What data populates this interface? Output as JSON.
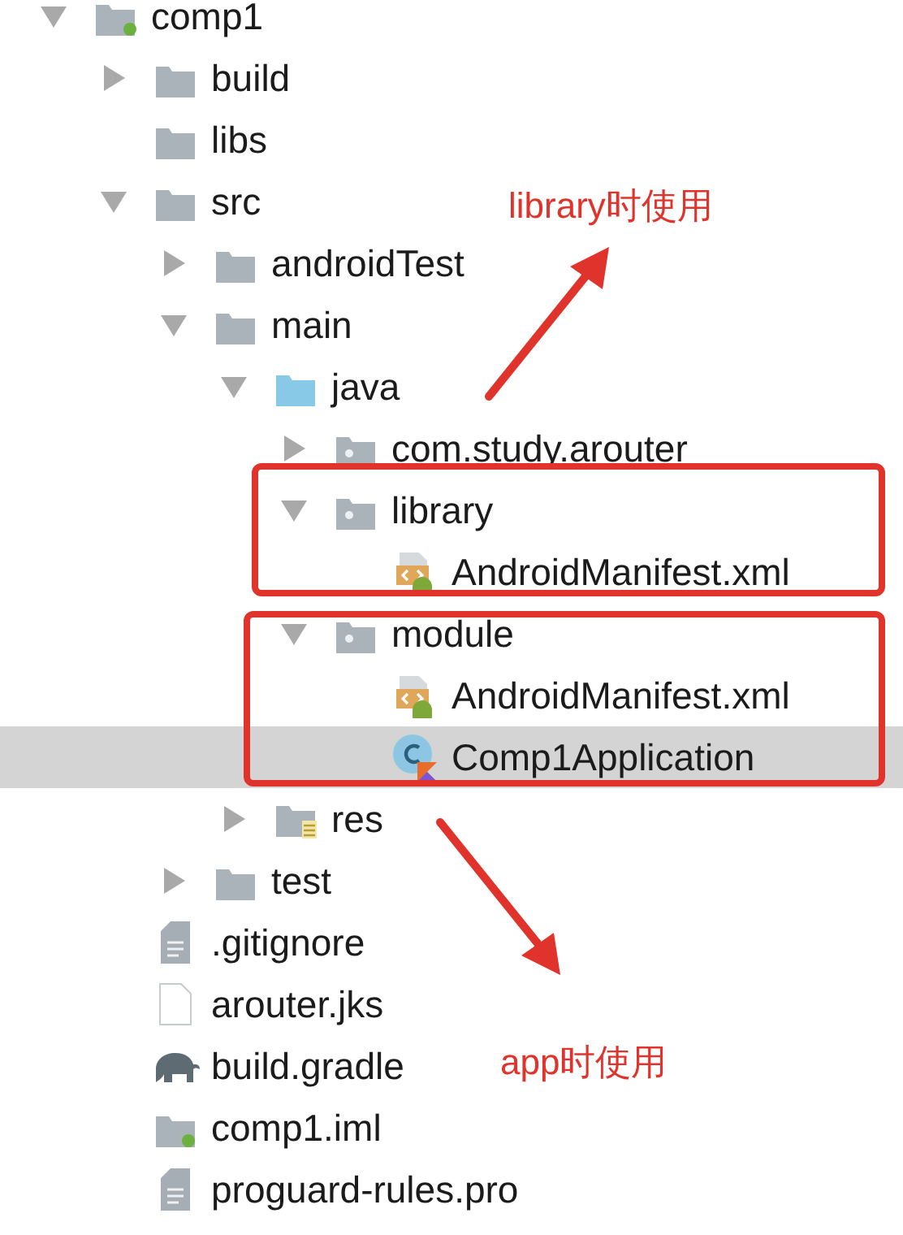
{
  "tree": [
    {
      "label": "comp1",
      "kind": "module",
      "expanded": true,
      "selected": false,
      "children": [
        {
          "label": "build",
          "kind": "folder",
          "expanded": false,
          "selected": false
        },
        {
          "label": "libs",
          "kind": "folder",
          "selected": false
        },
        {
          "label": "src",
          "kind": "folder",
          "expanded": true,
          "selected": false,
          "children": [
            {
              "label": "androidTest",
              "kind": "folder",
              "expanded": false,
              "selected": false
            },
            {
              "label": "main",
              "kind": "folder",
              "expanded": true,
              "selected": false,
              "children": [
                {
                  "label": "java",
                  "kind": "source",
                  "expanded": true,
                  "selected": false,
                  "children": [
                    {
                      "label": "com.study.arouter",
                      "kind": "package",
                      "expanded": false,
                      "selected": false
                    },
                    {
                      "label": "library",
                      "kind": "package",
                      "expanded": true,
                      "selected": false,
                      "children": [
                        {
                          "label": "AndroidManifest.xml",
                          "kind": "manifest",
                          "selected": false
                        }
                      ]
                    },
                    {
                      "label": "module",
                      "kind": "package",
                      "expanded": true,
                      "selected": false,
                      "children": [
                        {
                          "label": "AndroidManifest.xml",
                          "kind": "manifest",
                          "selected": false
                        },
                        {
                          "label": "Comp1Application",
                          "kind": "kotlin",
                          "selected": true
                        }
                      ]
                    }
                  ]
                },
                {
                  "label": "res",
                  "kind": "res",
                  "expanded": false,
                  "selected": false
                }
              ]
            },
            {
              "label": "test",
              "kind": "folder",
              "expanded": false,
              "selected": false
            }
          ]
        },
        {
          "label": ".gitignore",
          "kind": "text",
          "selected": false
        },
        {
          "label": "arouter.jks",
          "kind": "file",
          "selected": false
        },
        {
          "label": "build.gradle",
          "kind": "gradle",
          "selected": false
        },
        {
          "label": "comp1.iml",
          "kind": "iml",
          "selected": false
        },
        {
          "label": "proguard-rules.pro",
          "kind": "text",
          "selected": false
        }
      ]
    }
  ],
  "annotations": [
    {
      "text": "library时使用",
      "kind": "up"
    },
    {
      "text": "app时使用",
      "kind": "down"
    }
  ]
}
